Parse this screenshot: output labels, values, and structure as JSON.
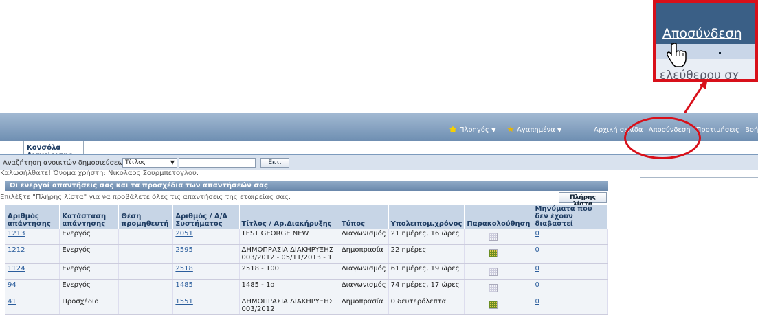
{
  "zoom_callout": {
    "link_label": "Αποσύνδεση",
    "blurred_text": "ελεύθερου σχ"
  },
  "header": {
    "nav_home": "Πλοηγός",
    "nav_favorites": "Αγαπημένα",
    "links": [
      "Αρχική σελίδα",
      "Αποσύνδεση",
      "Προτιμήσεις",
      "Βοήθεια"
    ]
  },
  "tab": {
    "label": "Κονσόλα Διαχείρισης"
  },
  "search": {
    "label": "Αναζήτηση ανοικτών δημοσιεύσεων",
    "select_value": "Τίτλος",
    "input_value": "",
    "go_label": "Εκτ."
  },
  "welcome": "Καλωσήλθατε! Όνομα χρήστη: Νικολαος Σουρμπετογλου.",
  "section": {
    "title": "Οι ενεργοί απαντήσεις σας και τα προσχέδια των απαντήσεών σας",
    "instructions": "Επιλέξτε \"Πλήρης λίστα\" για να προβάλετε όλες τις απαντήσεις της εταιρείας σας.",
    "full_list_label": "Πλήρης λίστα"
  },
  "table": {
    "headers": [
      "Αριθμός απάντησης",
      "Κατάσταση απάντησης",
      "Θέση προμηθευτή",
      "Αριθμός / Α/Α Συστήματος",
      "Τίτλος / Αρ.Διακήρυξης",
      "Τύπος",
      "Υπολειπομ.χρόνος",
      "Παρακολούθηση",
      "Μηνύματα που δεν έχουν διαβαστεί"
    ],
    "rows": [
      {
        "id": "1213",
        "status": "Ενεργός",
        "position": "",
        "system": "2051",
        "title": "TEST GEORGE NEW",
        "type": "Διαγωνισμός",
        "remaining": "21 ημέρες, 16 ώρες",
        "tracking": "gray",
        "unread": "0"
      },
      {
        "id": "1212",
        "status": "Ενεργός",
        "position": "",
        "system": "2595",
        "title": "ΔΗΜΟΠΡΑΣΙΑ ΔΙΑΚΗΡΥΞΗΣ 003/2012 - 05/11/2013 - 1",
        "type": "Δημοπρασία",
        "remaining": "22 ημέρες",
        "tracking": "color",
        "unread": "0"
      },
      {
        "id": "1124",
        "status": "Ενεργός",
        "position": "",
        "system": "2518",
        "title": "2518 - 100",
        "type": "Διαγωνισμός",
        "remaining": "61 ημέρες, 19 ώρες",
        "tracking": "gray",
        "unread": "0"
      },
      {
        "id": "94",
        "status": "Ενεργός",
        "position": "",
        "system": "1485",
        "title": "1485 - 1ο",
        "type": "Διαγωνισμός",
        "remaining": "74 ημέρες, 17 ώρες",
        "tracking": "gray",
        "unread": "0"
      },
      {
        "id": "41",
        "status": "Προσχέδιο",
        "position": "",
        "system": "1551",
        "title": "ΔΗΜΟΠΡΑΣΙΑ ΔΙΑΚΗΡΥΞΗΣ 003/2012",
        "type": "Δημοπρασία",
        "remaining": "0 δευτερόλεπτα",
        "tracking": "color",
        "unread": "0"
      }
    ]
  },
  "colors": {
    "annotation": "#d8101a",
    "header_top": "#a3bad3",
    "link": "#2b5d9c"
  }
}
